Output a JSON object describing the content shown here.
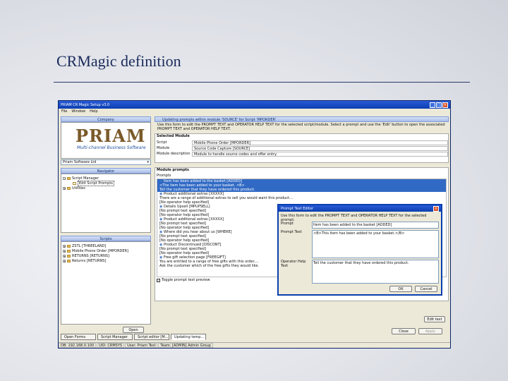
{
  "slide": {
    "title": "CRMagic definition"
  },
  "window": {
    "title": "PRIAM CR Magic Setup v3.0"
  },
  "menu": [
    "File",
    "Window",
    "Help"
  ],
  "left": {
    "company_head": "Company",
    "logo_main": "PRIAM",
    "logo_sub": "Multi-channel Business Software",
    "company_select": "Priam Software Ltd",
    "navigator_head": "Navigator",
    "tree": [
      {
        "label": "Script Manager",
        "level": 0
      },
      {
        "label": "Edit Script Prompts",
        "level": 1,
        "selected": true
      },
      {
        "label": "Utilities",
        "level": 0
      }
    ],
    "scripts_head": "Scripts",
    "scripts": [
      "ZSTL [THREELAND]",
      "Mobile Phone Order [MPORDER]",
      "RETURNS [RETURNS]",
      "Returns [RETURNS]"
    ],
    "open_button": "Open"
  },
  "right": {
    "head": "Updating prompts within module 'SOURCE' for Script 'MPORDER'",
    "instructions": "Use this form to edit the PROMPT TEXT and OPERATOR HELP TEXT for the selected script/module. Select a prompt and use the 'Edit' button to open the associated PROMPT TEXT and OPERATOR HELP TEXT.",
    "selected_module_head": "Selected Module",
    "fields": [
      {
        "label": "Script",
        "value": "Mobile Phone Order [MPORDER]"
      },
      {
        "label": "Module",
        "value": "Source Code Capture [SOURCE]"
      },
      {
        "label": "Module description",
        "value": "Module to handle source codes and offer entry."
      }
    ],
    "module_prompts_head": "Module prompts",
    "prompts_label": "Prompts",
    "prompts": [
      {
        "text": "Item has been added to the basket [ADDED]",
        "q": true,
        "hl": true
      },
      {
        "text": "<The item has been added to your basket. <B>",
        "q": false,
        "hl": true
      },
      {
        "text": "Tell the customer that they have ordered this product.",
        "q": false,
        "hl": true
      },
      {
        "text": "Product additional extras [XXXXX]",
        "q": true,
        "hl": false
      },
      {
        "text": "There are a range of additional extras to sell you would want this product...",
        "q": false,
        "hl": false
      },
      {
        "text": "[No operator help specified]",
        "q": false,
        "hl": false
      },
      {
        "text": "Details Upsell [MPUPSELL]",
        "q": true,
        "hl": false
      },
      {
        "text": "[No prompt text specified]",
        "q": false,
        "hl": false
      },
      {
        "text": "[No operator help specified]",
        "q": false,
        "hl": false
      },
      {
        "text": "Product additional extras [XXXXX]",
        "q": true,
        "hl": false
      },
      {
        "text": "[No prompt text specified]",
        "q": false,
        "hl": false
      },
      {
        "text": "[No operator help specified]",
        "q": false,
        "hl": false
      },
      {
        "text": "Where did you hear about us [WHERE]",
        "q": true,
        "hl": false
      },
      {
        "text": "[No prompt text specified]",
        "q": false,
        "hl": false
      },
      {
        "text": "[No operator help specified]",
        "q": false,
        "hl": false
      },
      {
        "text": "Product Discontinued [DISCONT]",
        "q": true,
        "hl": false
      },
      {
        "text": "[No prompt text specified]",
        "q": false,
        "hl": false
      },
      {
        "text": "[No operator help specified]",
        "q": false,
        "hl": false
      },
      {
        "text": "Free gift selection page [FREEGIFT]",
        "q": true,
        "hl": false
      },
      {
        "text": "You are entitled to a range of free gifts with this order....",
        "q": false,
        "hl": false
      },
      {
        "text": "Ask the customer which of the free gifts they would like.",
        "q": false,
        "hl": false
      }
    ],
    "toggle_label": "Toggle prompt text preview",
    "edit_button": "Edit text",
    "close_button": "Close",
    "apply_button": "Apply"
  },
  "dialog": {
    "title": "Prompt Text Editor",
    "instructions": "Use this form to edit the PROMPT TEXT and OPERATOR HELP TEXT for the selected prompt.",
    "prompt_label": "Prompt",
    "prompt_value": "Item has been added to the basket [ADDED]",
    "prompt_text_label": "Prompt Text",
    "prompt_text_value": "<B>This item has been added to your basket.</B>",
    "help_label": "Operator Help Text",
    "help_value": "Tell the customer that they have ordered this product.",
    "ok": "OK",
    "cancel": "Cancel"
  },
  "tabs": [
    "Open Forms",
    "Script Manager",
    "Script editor [M...",
    "Updating temp..."
  ],
  "status": [
    "DB: 192.168.0.100",
    "UID: CRMSYS",
    "User: Priam Test",
    "Team: [ADMIN] Admin Group"
  ]
}
